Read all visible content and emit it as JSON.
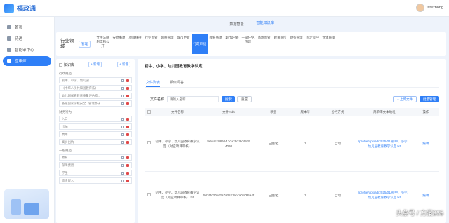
{
  "app": {
    "title": "福政通",
    "user": "fatezhong"
  },
  "sidebar": {
    "items": [
      {
        "label": "首页"
      },
      {
        "label": "待遇"
      },
      {
        "label": "智能审中心"
      },
      {
        "label": "应审师"
      }
    ]
  },
  "subnav": {
    "items": [
      "数据智能",
      "智能知识库"
    ]
  },
  "catbar": {
    "title": "行业领域",
    "manage": "管理",
    "categories": [
      "文件法规制度和公开",
      "安稳事项",
      "项目扶持",
      "行业监管",
      "网格管理",
      "城市更新",
      "行政审批",
      "教育事项",
      "超市环保",
      "干部任免管理",
      "市场监管",
      "教育医疗",
      "财务管理",
      "固定资产",
      "党建质量"
    ]
  },
  "tree": {
    "header": "知识库",
    "add": "+ 新增",
    "edit": "+ 新增",
    "group1": "行政规范",
    "group1_items": [
      "初中、小学、幼儿园...",
      "《中华人民共和国教育法》",
      "幼儿园保育教育质量评估指...",
      "各级国家学校安全...管理办法"
    ],
    "group2": "财务行为",
    "group2_items": [
      "入口",
      "出纳",
      "费用",
      "高价出纳"
    ],
    "group3": "一般规范",
    "group3_items": [
      "教育",
      "保障费用",
      "学生",
      "资金嵌入"
    ]
  },
  "main": {
    "title": "初中、小学、幼儿园教育教学认定",
    "tabs": [
      "文件列表",
      "相似问答"
    ],
    "search_label": "文件名称",
    "search_placeholder": "请输入名称",
    "search_btn": "搜索",
    "reset_btn": "重置",
    "upload_btn": "+ 上传文件",
    "batch_btn": "批量管理",
    "columns": [
      "文件名称",
      "文件md5",
      "状态",
      "版本号",
      "分行方式",
      "简单库文本地址",
      "操作"
    ],
    "rows": [
      {
        "name": "初中、小学、幼儿园教育教学认定（对应项目审核）",
        "md5": "fa94acc88604 3ce76c38c4979 4099",
        "status": "已量化",
        "version": "1",
        "method": "自动",
        "url": "/profile/upload/2025/01/初中、小学、幼儿园教育教学认定.txt",
        "op": "编辑"
      },
      {
        "name": "初中、小学、幼儿园教育教学认定（对应项目审核）.txt",
        "md5": "5026fc305d2a7a3571acda01085a4f",
        "status": "已量化",
        "version": "1",
        "method": "自动",
        "url": "/profile/upload/2025/01/初中、小学、幼儿园教育教学认定.txt",
        "op": "编辑"
      }
    ]
  },
  "watermark": "头条号 / 方案365"
}
